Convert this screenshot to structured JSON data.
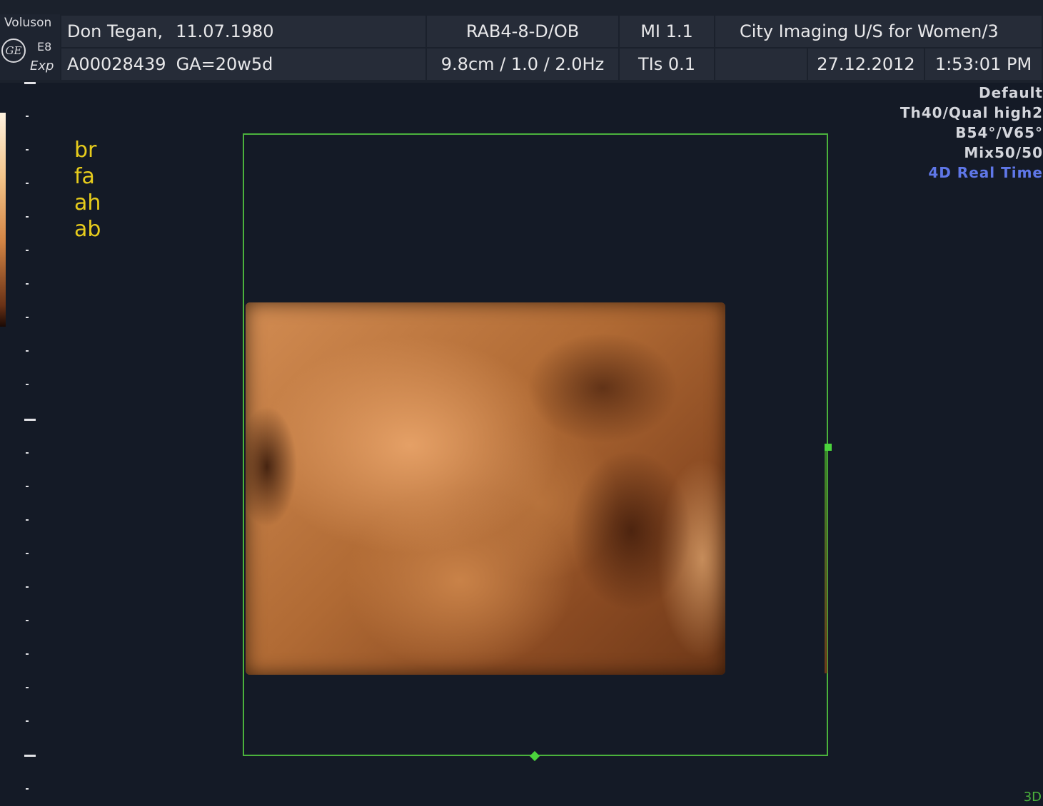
{
  "header": {
    "brand": "Voluson",
    "logo": "GE",
    "model": "E8",
    "edition": "Exp",
    "patient": "Don Tegan,",
    "dob": "11.07.1980",
    "patient_id": "A00028439",
    "gestational_age": "GA=20w5d",
    "probe_preset": "RAB4-8-D/OB",
    "depth_freq": "9.8cm / 1.0 / 2.0Hz",
    "mi": "MI  1.1",
    "tis": "TIs  0.1",
    "institution": "City Imaging U/S for Women/3",
    "date": "27.12.2012",
    "time": "1:53:01 PM"
  },
  "annotations": [
    "br",
    "fa",
    "ah",
    "ab"
  ],
  "params": {
    "preset": "Default",
    "quality": "Th40/Qual high2",
    "angles": "B54°/V65°",
    "mix": "Mix50/50",
    "mode": "4D Real Time"
  },
  "corner_tag": "3D",
  "colors": {
    "annotation": "#e7cc1c",
    "mode_text": "#5f77e8",
    "render_box": "#4bb23c",
    "background": "#141a26"
  }
}
